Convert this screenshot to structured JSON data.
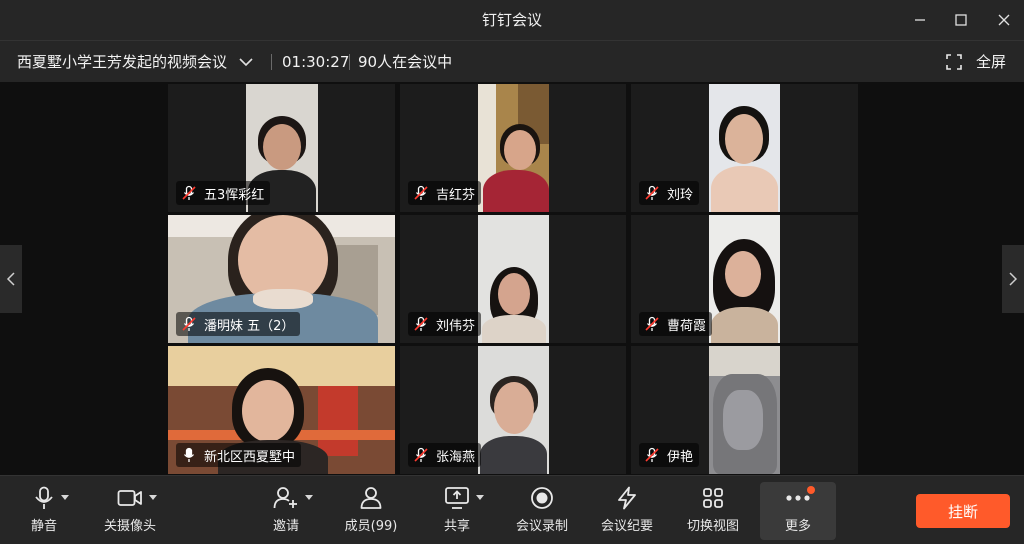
{
  "window": {
    "title": "钉钉会议"
  },
  "meeting": {
    "title": "西夏墅小学王芳发起的视频会议",
    "duration": "01:30:27",
    "participants_status": "90人在会议中",
    "fullscreen_label": "全屏"
  },
  "tiles": [
    {
      "name": "五3恽彩红",
      "mic": "muted"
    },
    {
      "name": "吉红芬",
      "mic": "muted"
    },
    {
      "name": "刘玲",
      "mic": "muted"
    },
    {
      "name": "潘明妹 五（2）",
      "mic": "muted"
    },
    {
      "name": "刘伟芬",
      "mic": "muted"
    },
    {
      "name": "曹荷霞",
      "mic": "muted"
    },
    {
      "name": "新北区西夏墅中",
      "mic": "on"
    },
    {
      "name": "张海燕",
      "mic": "muted"
    },
    {
      "name": "伊艳",
      "mic": "muted"
    }
  ],
  "toolbar": {
    "mute": "静音",
    "camera_off": "关摄像头",
    "invite": "邀请",
    "members": "成员(99)",
    "share": "共享",
    "record": "会议录制",
    "minutes": "会议纪要",
    "switch_view": "切换视图",
    "more": "更多",
    "hangup": "挂断"
  },
  "colors": {
    "accent": "#ff5a2a",
    "background": "#262626",
    "stage": "#0f0f0f"
  }
}
